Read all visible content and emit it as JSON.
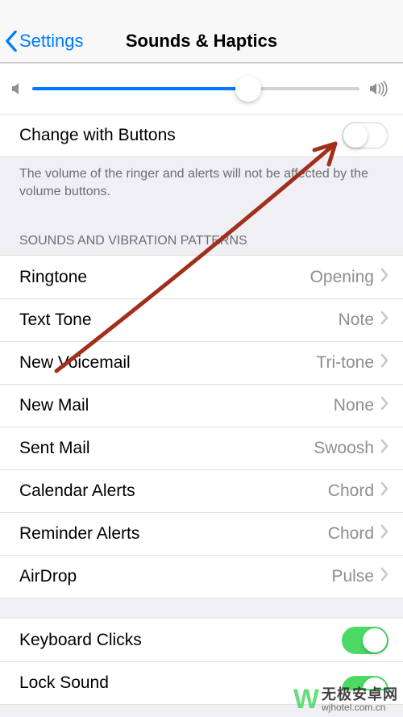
{
  "nav": {
    "back": "Settings",
    "title": "Sounds & Haptics"
  },
  "ringer": {
    "change_label": "Change with Buttons",
    "change_on": false,
    "footer": "The volume of the ringer and alerts will not be affected by the volume buttons."
  },
  "section_header": "SOUNDS AND VIBRATION PATTERNS",
  "sounds": [
    {
      "label": "Ringtone",
      "value": "Opening"
    },
    {
      "label": "Text Tone",
      "value": "Note"
    },
    {
      "label": "New Voicemail",
      "value": "Tri-tone"
    },
    {
      "label": "New Mail",
      "value": "None"
    },
    {
      "label": "Sent Mail",
      "value": "Swoosh"
    },
    {
      "label": "Calendar Alerts",
      "value": "Chord"
    },
    {
      "label": "Reminder Alerts",
      "value": "Chord"
    },
    {
      "label": "AirDrop",
      "value": "Pulse"
    }
  ],
  "system": [
    {
      "label": "Keyboard Clicks",
      "on": true
    },
    {
      "label": "Lock Sound",
      "on": true
    }
  ],
  "watermark": {
    "cn": "无极安卓网",
    "url": "wjhotel.com.cn"
  }
}
